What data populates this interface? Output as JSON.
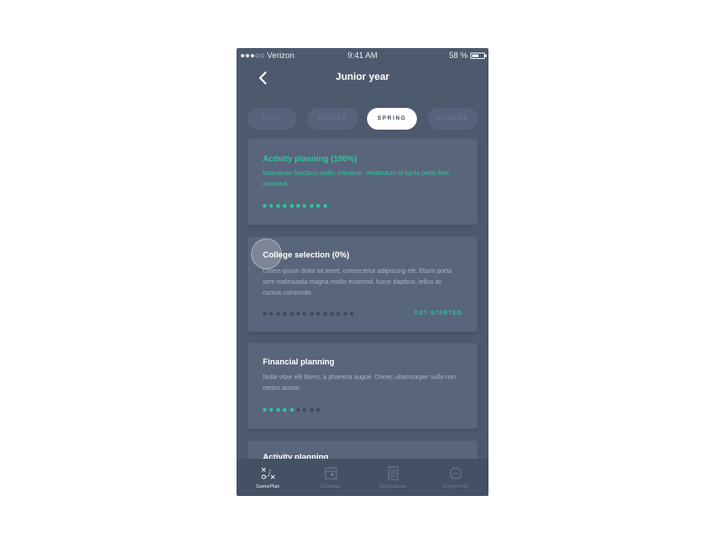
{
  "status_bar": {
    "carrier": "●●●○○ Verizon",
    "time": "9:41 AM",
    "battery": "58 %"
  },
  "nav": {
    "title": "Junior year",
    "back_icon": "chevron-left-icon"
  },
  "seasons": [
    {
      "label": "FALL",
      "active": false
    },
    {
      "label": "WINTER",
      "active": false
    },
    {
      "label": "SPRING",
      "active": true
    },
    {
      "label": "SUMMER",
      "active": false
    }
  ],
  "cards": [
    {
      "title": "Activity planning (100%)",
      "description": "Maecenas faucibus mollis interdum. Vestibulum id ligula porta felis euismod.",
      "progress_filled": 10,
      "progress_total": 10,
      "cta": ""
    },
    {
      "title": "College selection (0%)",
      "description": "Lorem ipsum dolor sit amet, consectetur adipiscing elit. Etiam porta sem malesuada magna mollis euismod, fusce dapibus, tellus ac cursus commodo.",
      "progress_filled": 0,
      "progress_total": 14,
      "cta": "GET STARTED"
    },
    {
      "title": "Financial planning",
      "description": "Nulla vitae elit libero, a pharetra augue. Donec ullamcorper nulla non metus auctor.",
      "progress_filled": 5,
      "progress_total": 9,
      "cta": ""
    }
  ],
  "peek_card_title": "Activity planning",
  "tabs": [
    {
      "label": "GamePlan",
      "icon": "gameplan-icon",
      "active": true
    },
    {
      "label": "Calendar",
      "icon": "calendar-icon",
      "active": false
    },
    {
      "label": "Applications",
      "icon": "document-icon",
      "active": false
    },
    {
      "label": "Expert help",
      "icon": "chat-icon",
      "active": false
    }
  ],
  "colors": {
    "background": "#4d5a6e",
    "card": "#58657a",
    "accent": "#2ec5a2",
    "text_light": "#ffffff"
  }
}
